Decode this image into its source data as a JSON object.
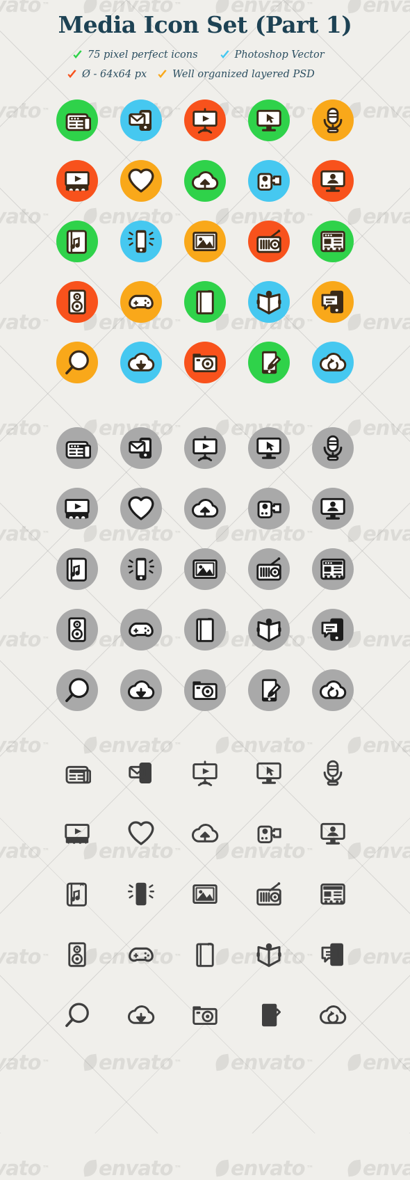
{
  "header": {
    "title": "Media Icon Set (Part 1)",
    "features": [
      {
        "check_color": "#2fd24a",
        "check_name": "green-check-icon",
        "label": "75 pixel perfect icons"
      },
      {
        "check_color": "#46c8f0",
        "check_name": "blue-check-icon",
        "label": "Photoshop Vector"
      },
      {
        "check_color": "#f8521c",
        "check_name": "red-check-icon",
        "label": "Ø - 64x64 px"
      },
      {
        "check_color": "#f9a81a",
        "check_name": "orange-check-icon",
        "label": "Well organized layered PSD"
      }
    ]
  },
  "watermark": {
    "text": "envato",
    "trademark": "™"
  },
  "palette": {
    "background": "#f0efeb",
    "title_color": "#1d4254",
    "glyph_dark": "#3a2a18",
    "glyph_light": "#ffffff",
    "gray_disc": "#a9a9a9",
    "gray_glyph": "#1c1c1c",
    "outline_glyph": "#3f3f3f",
    "green": "#2fd24a",
    "blue": "#46c8f0",
    "red": "#f8521c",
    "orange": "#f9a81a"
  },
  "sections": [
    {
      "name": "colored-circle-icons",
      "style": "filled-circle",
      "rows": [
        [
          {
            "icon": "news-icon",
            "disc": "#2fd24a"
          },
          {
            "icon": "mobile-mail-icon",
            "disc": "#46c8f0"
          },
          {
            "icon": "presentation-play-icon",
            "disc": "#f8521c"
          },
          {
            "icon": "monitor-cursor-icon",
            "disc": "#2fd24a"
          },
          {
            "icon": "microphone-icon",
            "disc": "#f9a81a"
          }
        ],
        [
          {
            "icon": "cinema-play-icon",
            "disc": "#f8521c"
          },
          {
            "icon": "heart-icon",
            "disc": "#f9a81a"
          },
          {
            "icon": "cloud-upload-icon",
            "disc": "#2fd24a"
          },
          {
            "icon": "camcorder-icon",
            "disc": "#46c8f0"
          },
          {
            "icon": "monitor-user-icon",
            "disc": "#f8521c"
          }
        ],
        [
          {
            "icon": "music-book-icon",
            "disc": "#2fd24a"
          },
          {
            "icon": "phone-vibrate-icon",
            "disc": "#46c8f0"
          },
          {
            "icon": "photo-icon",
            "disc": "#f9a81a"
          },
          {
            "icon": "radio-icon",
            "disc": "#f8521c"
          },
          {
            "icon": "web-layout-icon",
            "disc": "#2fd24a"
          }
        ],
        [
          {
            "icon": "speaker-icon",
            "disc": "#f8521c"
          },
          {
            "icon": "gamepad-icon",
            "disc": "#f9a81a"
          },
          {
            "icon": "notebook-icon",
            "disc": "#2fd24a"
          },
          {
            "icon": "open-book-icon",
            "disc": "#46c8f0"
          },
          {
            "icon": "mobile-chat-icon",
            "disc": "#f9a81a"
          }
        ],
        [
          {
            "icon": "magnifier-icon",
            "disc": "#f9a81a"
          },
          {
            "icon": "cloud-download-icon",
            "disc": "#46c8f0"
          },
          {
            "icon": "camera-icon",
            "disc": "#f8521c"
          },
          {
            "icon": "tablet-pen-icon",
            "disc": "#2fd24a"
          },
          {
            "icon": "cloud-sync-icon",
            "disc": "#46c8f0"
          }
        ]
      ]
    },
    {
      "name": "gray-circle-icons",
      "style": "gray-circle",
      "rows": [
        [
          {
            "icon": "news-icon",
            "disc": "#a9a9a9"
          },
          {
            "icon": "mobile-mail-icon",
            "disc": "#a9a9a9"
          },
          {
            "icon": "presentation-play-icon",
            "disc": "#a9a9a9"
          },
          {
            "icon": "monitor-cursor-icon",
            "disc": "#a9a9a9"
          },
          {
            "icon": "microphone-icon",
            "disc": "#a9a9a9"
          }
        ],
        [
          {
            "icon": "cinema-play-icon",
            "disc": "#a9a9a9"
          },
          {
            "icon": "heart-icon",
            "disc": "#a9a9a9"
          },
          {
            "icon": "cloud-upload-icon",
            "disc": "#a9a9a9"
          },
          {
            "icon": "camcorder-icon",
            "disc": "#a9a9a9"
          },
          {
            "icon": "monitor-user-icon",
            "disc": "#a9a9a9"
          }
        ],
        [
          {
            "icon": "music-book-icon",
            "disc": "#a9a9a9"
          },
          {
            "icon": "phone-vibrate-icon",
            "disc": "#a9a9a9"
          },
          {
            "icon": "photo-icon",
            "disc": "#a9a9a9"
          },
          {
            "icon": "radio-icon",
            "disc": "#a9a9a9"
          },
          {
            "icon": "web-layout-icon",
            "disc": "#a9a9a9"
          }
        ],
        [
          {
            "icon": "speaker-icon",
            "disc": "#a9a9a9"
          },
          {
            "icon": "gamepad-icon",
            "disc": "#a9a9a9"
          },
          {
            "icon": "notebook-icon",
            "disc": "#a9a9a9"
          },
          {
            "icon": "open-book-icon",
            "disc": "#a9a9a9"
          },
          {
            "icon": "mobile-chat-icon",
            "disc": "#a9a9a9"
          }
        ],
        [
          {
            "icon": "magnifier-icon",
            "disc": "#a9a9a9"
          },
          {
            "icon": "cloud-download-icon",
            "disc": "#a9a9a9"
          },
          {
            "icon": "camera-icon",
            "disc": "#a9a9a9"
          },
          {
            "icon": "tablet-pen-icon",
            "disc": "#a9a9a9"
          },
          {
            "icon": "cloud-sync-icon",
            "disc": "#a9a9a9"
          }
        ]
      ]
    },
    {
      "name": "outline-icons",
      "style": "plain",
      "rows": [
        [
          {
            "icon": "news-icon"
          },
          {
            "icon": "mobile-mail-icon"
          },
          {
            "icon": "presentation-play-icon"
          },
          {
            "icon": "monitor-cursor-icon"
          },
          {
            "icon": "microphone-icon"
          }
        ],
        [
          {
            "icon": "cinema-play-icon"
          },
          {
            "icon": "heart-icon"
          },
          {
            "icon": "cloud-upload-icon"
          },
          {
            "icon": "camcorder-icon"
          },
          {
            "icon": "monitor-user-icon"
          }
        ],
        [
          {
            "icon": "music-book-icon"
          },
          {
            "icon": "phone-vibrate-icon"
          },
          {
            "icon": "photo-icon"
          },
          {
            "icon": "radio-icon"
          },
          {
            "icon": "web-layout-icon"
          }
        ],
        [
          {
            "icon": "speaker-icon"
          },
          {
            "icon": "gamepad-icon"
          },
          {
            "icon": "notebook-icon"
          },
          {
            "icon": "open-book-icon"
          },
          {
            "icon": "mobile-chat-icon"
          }
        ],
        [
          {
            "icon": "magnifier-icon"
          },
          {
            "icon": "cloud-download-icon"
          },
          {
            "icon": "camera-icon"
          },
          {
            "icon": "tablet-pen-icon"
          },
          {
            "icon": "cloud-sync-icon"
          }
        ]
      ]
    }
  ]
}
